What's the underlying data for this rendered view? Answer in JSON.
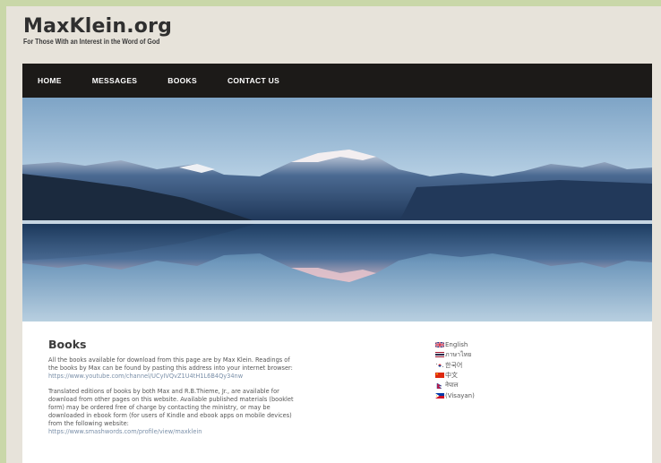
{
  "site": {
    "title": "MaxKlein.org",
    "tagline": "For Those With an Interest in the Word of God"
  },
  "nav": {
    "items": [
      {
        "label": "HOME"
      },
      {
        "label": "MESSAGES"
      },
      {
        "label": "BOOKS"
      },
      {
        "label": "CONTACT US"
      }
    ]
  },
  "hero": {
    "description_icon": "mountain-lake-photo"
  },
  "page": {
    "title": "Books",
    "para1": [
      "All the books available for download from this page are by Max Klein. Readings of",
      "the books by Max can be found by pasting this address into your internet browser:",
      "https://www.youtube.com/channel/UCyIVQvZ1U4tH1L6B4Qy34nw"
    ],
    "para2": [
      "Translated editions of books by both Max and R.B.Thieme, Jr., are available for",
      "download from other pages on this website. Available published materials (booklet",
      "form) may be ordered free of charge by contacting the ministry, or may be",
      "downloaded in ebook form (for users of Kindle and ebook apps on mobile devices)",
      "from the following website:",
      "https://www.smashwords.com/profile/view/maxklein"
    ]
  },
  "languages": [
    {
      "label": "English",
      "flag": "uk-flag-icon"
    },
    {
      "label": "ภาษาไทย",
      "flag": "thai-flag-icon"
    },
    {
      "label": "한국어",
      "flag": "korean-flag-icon"
    },
    {
      "label": "中文",
      "flag": "china-flag-icon"
    },
    {
      "label": "नेपाल",
      "flag": "nepal-flag-icon"
    },
    {
      "label": "(Visayan)",
      "flag": "philippines-flag-icon"
    }
  ],
  "colors": {
    "nav_bg": "#1c1a18",
    "page_bg": "#e7e3da",
    "outer_bg": "#c9d7a8"
  }
}
